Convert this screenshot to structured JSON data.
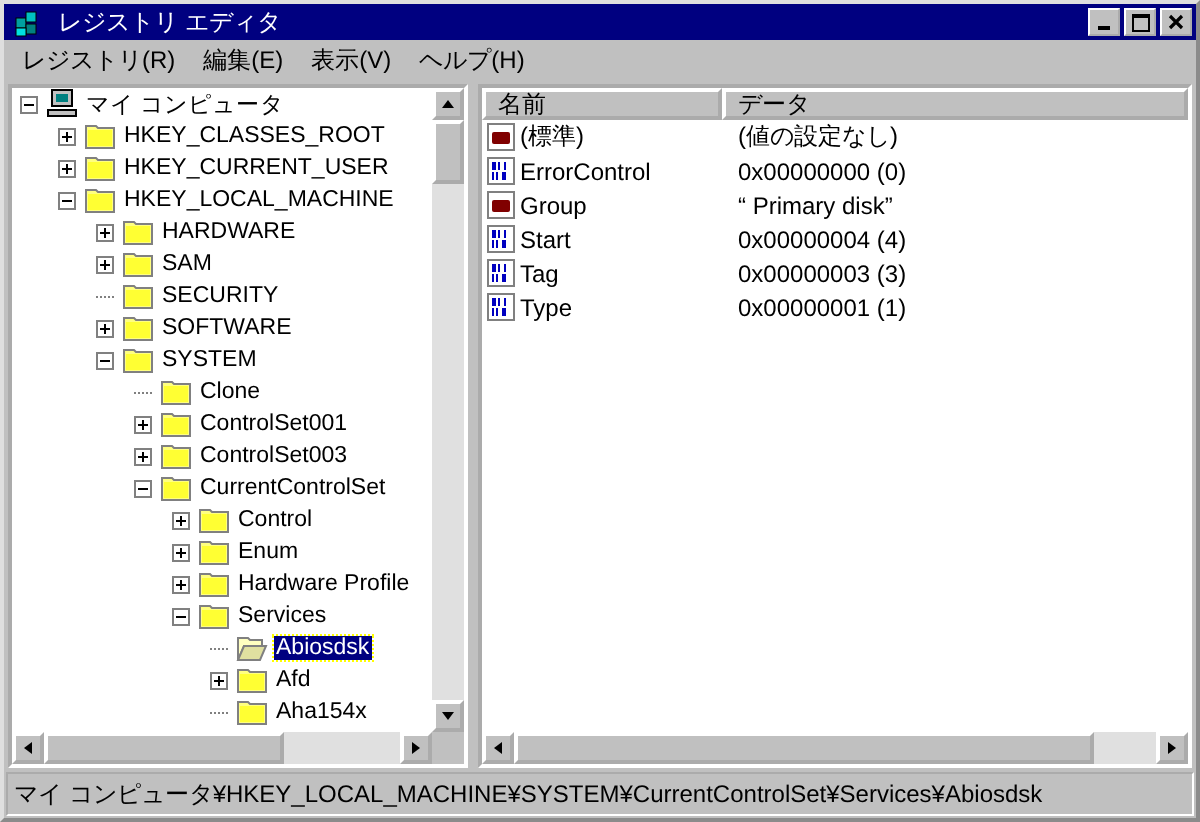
{
  "window": {
    "title": "レジストリ エディタ"
  },
  "menu": [
    "レジストリ(R)",
    "編集(E)",
    "表示(V)",
    "ヘルプ(H)"
  ],
  "tree": [
    {
      "label": "マイ コンピュータ",
      "kind": "computer",
      "has_children": true,
      "expanded": true,
      "selected": false,
      "children": [
        {
          "label": "HKEY_CLASSES_ROOT",
          "kind": "folder",
          "has_children": true,
          "expanded": false,
          "selected": false
        },
        {
          "label": "HKEY_CURRENT_USER",
          "kind": "folder",
          "has_children": true,
          "expanded": false,
          "selected": false
        },
        {
          "label": "HKEY_LOCAL_MACHINE",
          "kind": "folder",
          "has_children": true,
          "expanded": true,
          "selected": false,
          "children": [
            {
              "label": "HARDWARE",
              "kind": "folder",
              "has_children": true,
              "expanded": false,
              "selected": false
            },
            {
              "label": "SAM",
              "kind": "folder",
              "has_children": true,
              "expanded": false,
              "selected": false
            },
            {
              "label": "SECURITY",
              "kind": "folder",
              "has_children": false,
              "selected": false
            },
            {
              "label": "SOFTWARE",
              "kind": "folder",
              "has_children": true,
              "expanded": false,
              "selected": false
            },
            {
              "label": "SYSTEM",
              "kind": "folder",
              "has_children": true,
              "expanded": true,
              "selected": false,
              "children": [
                {
                  "label": "Clone",
                  "kind": "folder",
                  "has_children": false,
                  "selected": false
                },
                {
                  "label": "ControlSet001",
                  "kind": "folder",
                  "has_children": true,
                  "expanded": false,
                  "selected": false
                },
                {
                  "label": "ControlSet003",
                  "kind": "folder",
                  "has_children": true,
                  "expanded": false,
                  "selected": false
                },
                {
                  "label": "CurrentControlSet",
                  "kind": "folder",
                  "has_children": true,
                  "expanded": true,
                  "selected": false,
                  "children": [
                    {
                      "label": "Control",
                      "kind": "folder",
                      "has_children": true,
                      "expanded": false,
                      "selected": false
                    },
                    {
                      "label": "Enum",
                      "kind": "folder",
                      "has_children": true,
                      "expanded": false,
                      "selected": false
                    },
                    {
                      "label": "Hardware Profile",
                      "kind": "folder",
                      "has_children": true,
                      "expanded": false,
                      "selected": false
                    },
                    {
                      "label": "Services",
                      "kind": "folder",
                      "has_children": true,
                      "expanded": true,
                      "selected": false,
                      "children": [
                        {
                          "label": "Abiosdsk",
                          "kind": "folder",
                          "has_children": false,
                          "selected": true
                        },
                        {
                          "label": "Afd",
                          "kind": "folder",
                          "has_children": true,
                          "expanded": false,
                          "selected": false
                        },
                        {
                          "label": "Aha154x",
                          "kind": "folder",
                          "has_children": false,
                          "selected": false
                        }
                      ]
                    }
                  ]
                }
              ]
            }
          ]
        }
      ]
    }
  ],
  "values": {
    "columns": [
      "名前",
      "データ"
    ],
    "rows": [
      {
        "name": "(標準)",
        "kind": "string",
        "data": "(値の設定なし)"
      },
      {
        "name": "ErrorControl",
        "kind": "binary",
        "data": "0x00000000 (0)"
      },
      {
        "name": "Group",
        "kind": "string",
        "data": "“ Primary disk”"
      },
      {
        "name": "Start",
        "kind": "binary",
        "data": "0x00000004 (4)"
      },
      {
        "name": "Tag",
        "kind": "binary",
        "data": "0x00000003 (3)"
      },
      {
        "name": "Type",
        "kind": "binary",
        "data": "0x00000001 (1)"
      }
    ]
  },
  "status_bar": "マイ コンピュータ¥HKEY_LOCAL_MACHINE¥SYSTEM¥CurrentControlSet¥Services¥Abiosdsk"
}
